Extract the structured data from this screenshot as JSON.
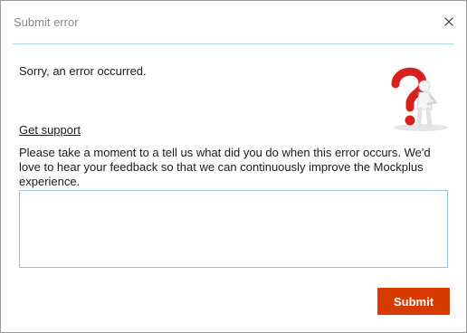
{
  "dialog": {
    "title": "Submit error",
    "close_icon": "close-icon"
  },
  "content": {
    "message": "Sorry, an error occurred.",
    "illustration_icon": "question-mark-figure-icon",
    "support_link": "Get support",
    "description": "Please take a moment to a tell us what did you do when this error occurs. We'd love to hear your feedback so that we can continuously improve the Mockplus experience.",
    "feedback_value": "",
    "feedback_placeholder": ""
  },
  "actions": {
    "submit_label": "Submit"
  },
  "colors": {
    "accent": "#d83b01",
    "divider": "#a9d8ea",
    "input_border": "#8fc2d8",
    "illustration_red": "#d8201e"
  }
}
